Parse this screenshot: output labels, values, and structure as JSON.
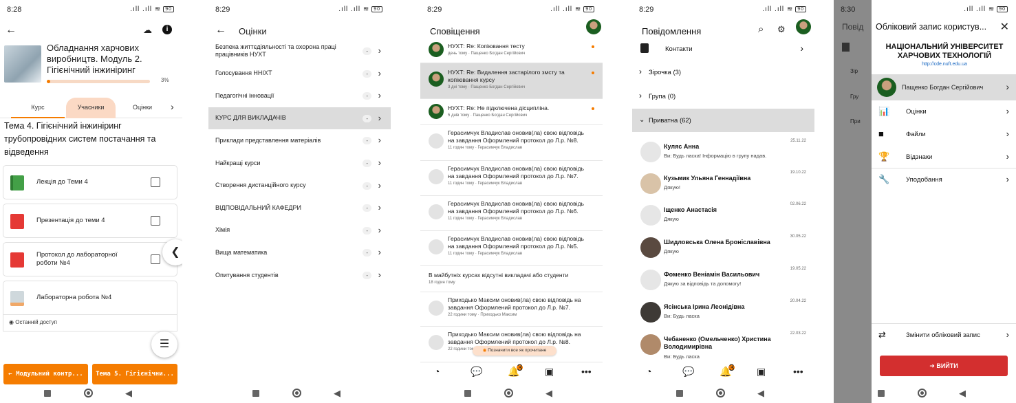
{
  "screen1": {
    "time": "8:28",
    "battery": "90",
    "course_title": "Обладнання харчових виробництв. Модуль 2. Гігієнічний інжиніринг",
    "progress_percent": 3,
    "progress_label": "3%",
    "tabs": [
      "Курс",
      "Учасники",
      "Оцінки"
    ],
    "topic_title": "Тема 4. Гігієнічний інжиніринг трубопровідних систем постачання та відведення",
    "activities": [
      {
        "label": "Лекція до Теми 4"
      },
      {
        "label": "Презентація до теми 4"
      },
      {
        "label": "Протокол до лабораторної роботи №4"
      },
      {
        "label": "Лабораторна робота №4"
      }
    ],
    "last_access": "Останній доступ",
    "prev_button": "Модульний контр...",
    "next_button": "Тема 5. Гігієнічни..."
  },
  "screen2": {
    "time": "8:29",
    "battery": "90",
    "title": "Оцінки",
    "courses": [
      {
        "name": "Безпека життєдіяльності та охорона праці працівників НУХТ",
        "grade": "-"
      },
      {
        "name": "Голосування ННІХТ",
        "grade": "-"
      },
      {
        "name": "Педагогічні інновації",
        "grade": "-"
      },
      {
        "name": "КУРС ДЛЯ ВИКЛАДАЧІВ",
        "grade": "-"
      },
      {
        "name": "Приклади представлення матеріалів",
        "grade": "-"
      },
      {
        "name": "Найкращі курси",
        "grade": "-"
      },
      {
        "name": "Створення дистанційного курсу",
        "grade": "-"
      },
      {
        "name": "ВІДПОВІДАЛЬНИЙ КАФЕДРИ",
        "grade": "-"
      },
      {
        "name": "Хімія",
        "grade": "-"
      },
      {
        "name": "Вища математика",
        "grade": "-"
      },
      {
        "name": "Опитування студентів",
        "grade": "-"
      }
    ]
  },
  "screen3": {
    "time": "8:29",
    "battery": "90",
    "title": "Сповіщення",
    "notifications": [
      {
        "text": "НУХТ: Re: Копіювання тесту",
        "meta": "день тому · Пащенко Богдан Сергійович"
      },
      {
        "text": "НУХТ: Re: Видалення застарілого змсту та копіювання курсу",
        "meta": "3 дні тому · Пащенко Богдан Сергійович"
      },
      {
        "text": "НУХТ: Re: Не підключена дісципліна.",
        "meta": "5 днів тому · Пащенко Богдан Сергійович"
      },
      {
        "text": "Герасимчук Владислав оновив(ла) свою відповідь на завдання Оформлений протокол до Л.р. №8.",
        "meta": "11 годин тому · Герасимчук Владислав"
      },
      {
        "text": "Герасимчук Владислав оновив(ла) свою відповідь на завдання Оформлений протокол до Л.р. №7.",
        "meta": "11 годин тому · Герасимчук Владислав"
      },
      {
        "text": "Герасимчук Владислав оновив(ла) свою відповідь на завдання Оформлений протокол до Л.р. №6.",
        "meta": "11 годин тому · Герасимчук Владислав"
      },
      {
        "text": "Герасимчук Владислав оновив(ла) свою відповідь на завдання Оформлений протокол до Л.р. №5.",
        "meta": "11 годин тому · Герасимчук Владислав"
      },
      {
        "text": "В майбутніх курсах відсутні викладачі або студенти",
        "meta": "18 годин тому"
      },
      {
        "text": "Приходько Максим оновив(ла) свою відповідь на завдання Оформлений протокол до Л.р. №7.",
        "meta": "22 години тому · Приходько Максим"
      },
      {
        "text": "Приходько Максим оновив(ла) свою відповідь на завдання Оформлений протокол до Л.р. №8.",
        "meta": "22 години тому"
      }
    ],
    "mark_all_read": "Позначити все як прочитане",
    "badge": "3"
  },
  "screen4": {
    "time": "8:29",
    "battery": "90",
    "title": "Повідомлення",
    "contacts": "Контакти",
    "sections": [
      "Зірочка (3)",
      "Група (0)",
      "Приватна (62)"
    ],
    "conversations": [
      {
        "name": "Куляс Анна",
        "msg": "Ви: Будь ласка! Інформацію в групу надав.",
        "date": "25.11.22"
      },
      {
        "name": "Кузьмик Ульяна Геннадіївна",
        "msg": "Дякую!",
        "date": "19.10.22"
      },
      {
        "name": "Іщенко Анастасія",
        "msg": "Дякую",
        "date": "02.06.22"
      },
      {
        "name": "Шидловська Олена Броніславівна",
        "msg": "Дякую",
        "date": "30.05.22"
      },
      {
        "name": "Фоменко Веніамін Васильович",
        "msg": "Дякую за відповідь та допомогу!",
        "date": "19.05.22"
      },
      {
        "name": "Ясінська Ірина Леонідівна",
        "msg": "Ви: Будь ласка",
        "date": "20.04.22"
      },
      {
        "name": "Чебаненко (Омельченко) Христина Володимирівна",
        "msg": "Ви: Будь ласка",
        "date": "22.03.22"
      }
    ],
    "badge": "3"
  },
  "screen5": {
    "time": "8:30",
    "battery": "90",
    "drawer_title": "Обліковий запис користув...",
    "university": "НАЦІОНАЛЬНИЙ УНІВЕРСИТЕТ ХАРЧОВИХ ТЕХНОЛОГІЙ",
    "site_url": "http://cde.nuft.edu.ua",
    "user_name": "Пащенко Богдан Сергійович",
    "menu": [
      "Оцінки",
      "Файли",
      "Відзнаки",
      "Уподобання"
    ],
    "switch_account": "Змінити обліковий запис",
    "logout": "ВИЙТИ",
    "behind_title": "Повід",
    "behind_rows": [
      "Зір",
      "Гру",
      "При"
    ]
  },
  "colors": {
    "accent": "#f57c00",
    "selected_row": "#dcdcdc",
    "logout": "#d32f2f",
    "link": "#1565c0"
  }
}
